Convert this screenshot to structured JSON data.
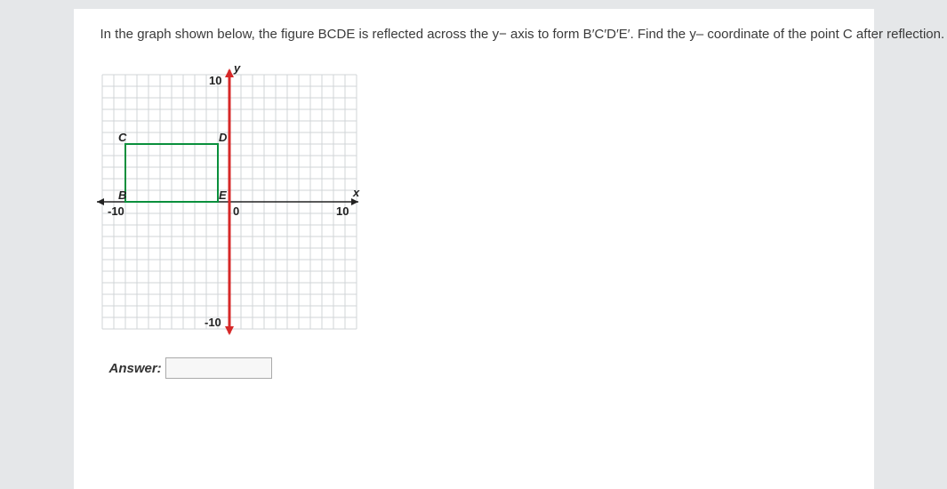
{
  "question": "In the graph shown below, the figure BCDE is reflected across the y− axis to form B′C′D′E′. Find the y– coordinate of the point C after reflection.",
  "answer_label": "Answer:",
  "answer_value": "",
  "graph": {
    "xmin": -11,
    "xmax": 11,
    "ymin": -11,
    "ymax": 11,
    "xticks": [
      -10,
      0,
      10
    ],
    "yticks": [
      -10,
      10
    ],
    "xlabel": "x",
    "ylabel": "y",
    "points": {
      "B": {
        "x": -9,
        "y": 0
      },
      "C": {
        "x": -9,
        "y": 5
      },
      "D": {
        "x": -1,
        "y": 5
      },
      "E": {
        "x": -1,
        "y": 0
      }
    }
  },
  "chart_data": {
    "type": "scatter",
    "title": "",
    "xlabel": "x",
    "ylabel": "y",
    "xlim": [
      -10,
      10
    ],
    "ylim": [
      -10,
      10
    ],
    "series": [
      {
        "name": "BCDE",
        "x": [
          -9,
          -9,
          -1,
          -1
        ],
        "y": [
          0,
          5,
          5,
          0
        ],
        "labels": [
          "B",
          "C",
          "D",
          "E"
        ]
      }
    ],
    "grid": true
  }
}
